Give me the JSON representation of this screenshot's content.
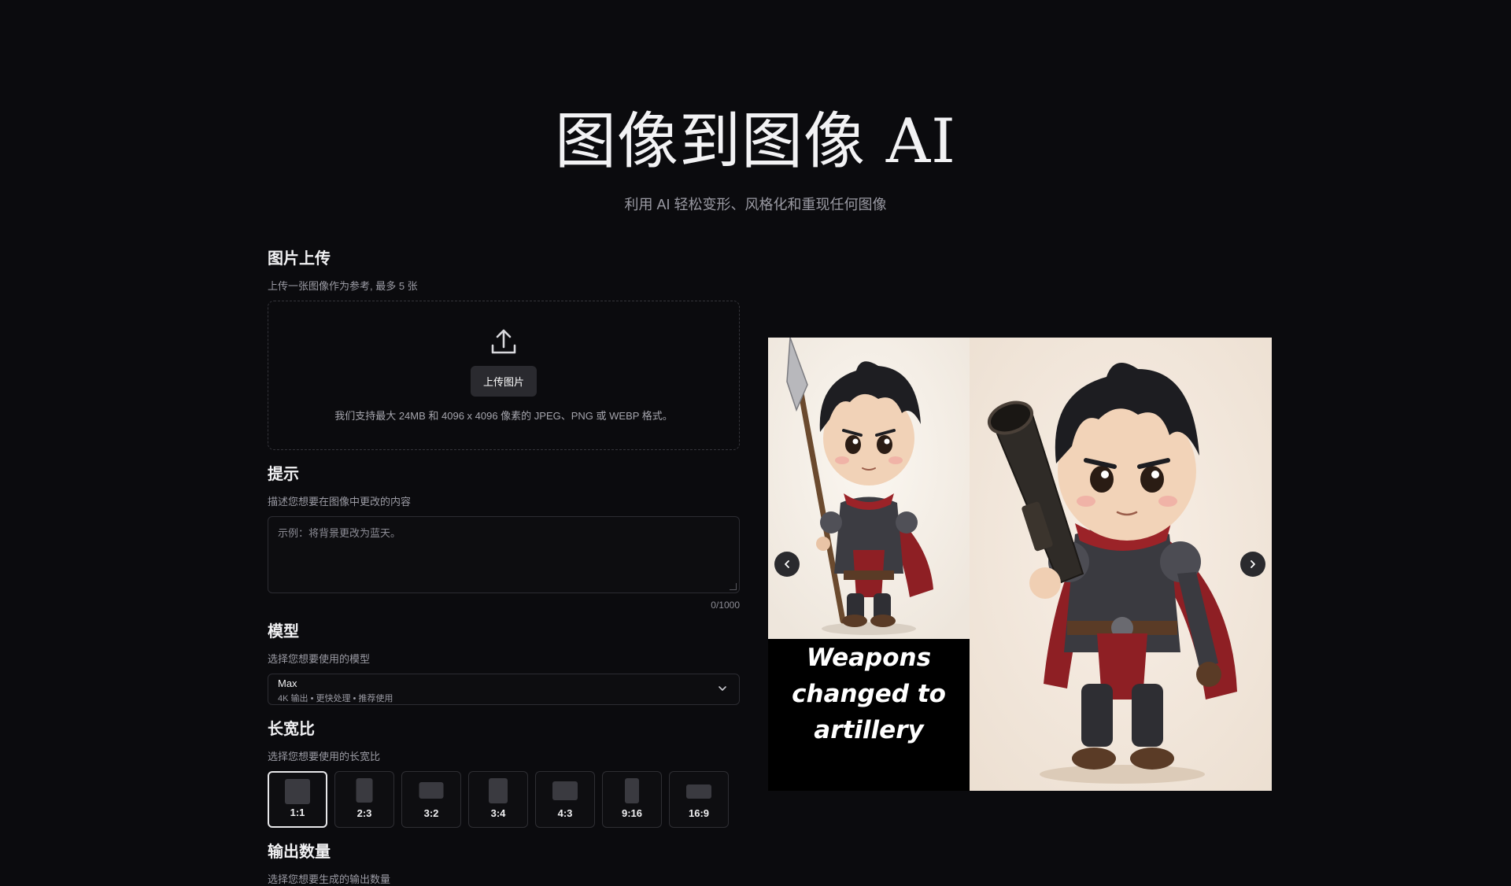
{
  "hero": {
    "title": "图像到图像 AI",
    "subtitle": "利用 AI 轻松变形、风格化和重现任何图像"
  },
  "upload": {
    "title": "图片上传",
    "description": "上传一张图像作为参考, 最多 5 张",
    "button_label": "上传图片",
    "hint": "我们支持最大 24MB 和 4096 x 4096 像素的 JPEG、PNG 或 WEBP 格式。",
    "icon": "upload-icon"
  },
  "prompt": {
    "title": "提示",
    "description": "描述您想要在图像中更改的内容",
    "placeholder": "示例：将背景更改为蓝天。",
    "counter": "0/1000"
  },
  "model": {
    "title": "模型",
    "description": "选择您想要使用的模型",
    "selected_name": "Max",
    "selected_detail": "4K 输出 • 更快处理 • 推荐使用",
    "icon": "chevron-down-icon"
  },
  "aspect_ratio": {
    "title": "长宽比",
    "description": "选择您想要使用的长宽比",
    "selected": "1:1",
    "options": [
      "1:1",
      "2:3",
      "3:2",
      "3:4",
      "4:3",
      "9:16",
      "16:9"
    ]
  },
  "output_count": {
    "title": "输出数量",
    "description": "选择您想要生成的输出数量"
  },
  "carousel": {
    "caption_lines": [
      "Weapons",
      "changed to",
      "artillery"
    ],
    "prev_icon": "chevron-left-icon",
    "next_icon": "chevron-right-icon"
  },
  "colors": {
    "background": "#0b0b0e",
    "selected_border": "#e8e8ea",
    "cape_red": "#8e1f24"
  }
}
